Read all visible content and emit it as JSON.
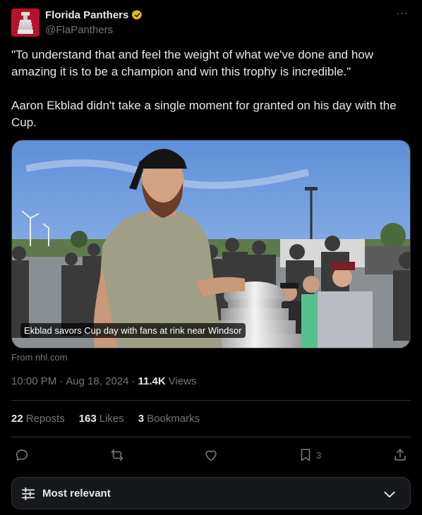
{
  "account": {
    "display_name": "Florida Panthers",
    "handle": "@FlaPanthers",
    "verified_icon": "verified-badge-icon",
    "brand_color": "#b5122e"
  },
  "tweet": {
    "paragraph_1": "\"To understand that and feel the weight of what we've done and how amazing it is to be a champion and win this trophy is incredible.\"",
    "paragraph_2": "Aaron Ekblad didn't take a single moment for granted on his day with the Cup."
  },
  "media": {
    "caption": "Ekblad savors Cup day with fans at rink near Windsor",
    "source": "From nhl.com"
  },
  "meta": {
    "time": "10:00 PM",
    "separator": "·",
    "date": "Aug 18, 2024",
    "views_count": "11.4K",
    "views_label": "Views"
  },
  "stats": {
    "reposts_count": "22",
    "reposts_label": "Reposts",
    "likes_count": "163",
    "likes_label": "Likes",
    "bookmarks_count": "3",
    "bookmarks_label": "Bookmarks"
  },
  "actions": {
    "bookmark_count": "3",
    "icons": [
      "reply-icon",
      "repost-icon",
      "like-icon",
      "bookmark-icon",
      "share-icon"
    ]
  },
  "sort": {
    "label": "Most relevant"
  },
  "colors": {
    "background": "#000000",
    "text": "#e7e9ea",
    "secondary": "#71767b",
    "border": "#2f3336",
    "verified_gold": "#e2b719"
  }
}
